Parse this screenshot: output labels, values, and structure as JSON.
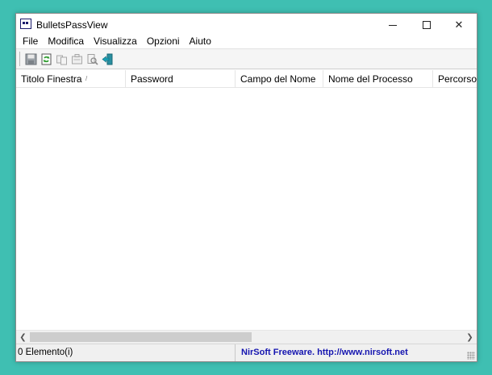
{
  "window": {
    "title": "BulletsPassView"
  },
  "menu": [
    "File",
    "Modifica",
    "Visualizza",
    "Opzioni",
    "Aiuto"
  ],
  "toolbar": {
    "buttons": [
      "save-icon",
      "refresh-icon",
      "copy-icon",
      "properties-icon",
      "find-icon",
      "exit-icon"
    ]
  },
  "columns": [
    {
      "label": "Titolo Finestra",
      "sorted": "/"
    },
    {
      "label": "Password"
    },
    {
      "label": "Campo del Nome"
    },
    {
      "label": "Nome del Processo"
    },
    {
      "label": "Percorso d"
    }
  ],
  "status": {
    "count": "0 Elemento(i)",
    "credit": "NirSoft Freeware.  http://www.nirsoft.net"
  },
  "colors": {
    "desktop": "#3fbfb2",
    "link": "#1515b0"
  }
}
